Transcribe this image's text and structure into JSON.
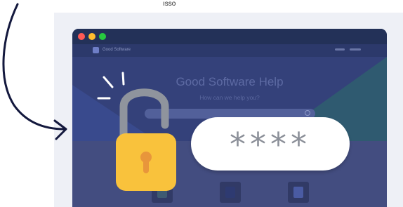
{
  "browser": {
    "window_controls": [
      "close-dot",
      "minimize-dot",
      "maximize-dot"
    ]
  },
  "site": {
    "brand": "Good Software",
    "hero_title": "Good Software Help",
    "hero_subtitle": "How can we help you?",
    "search_placeholder": ""
  },
  "overlay": {
    "password_mask": "****",
    "lock_state": "unlocked"
  },
  "watermark_fragment": "ısso",
  "colors": {
    "background_panel": "#eef0f6",
    "browser_dark": "#24305a",
    "lock_yellow": "#f9c23c",
    "shackle_gray": "#8f949d",
    "password_text": "#8b8f98"
  }
}
